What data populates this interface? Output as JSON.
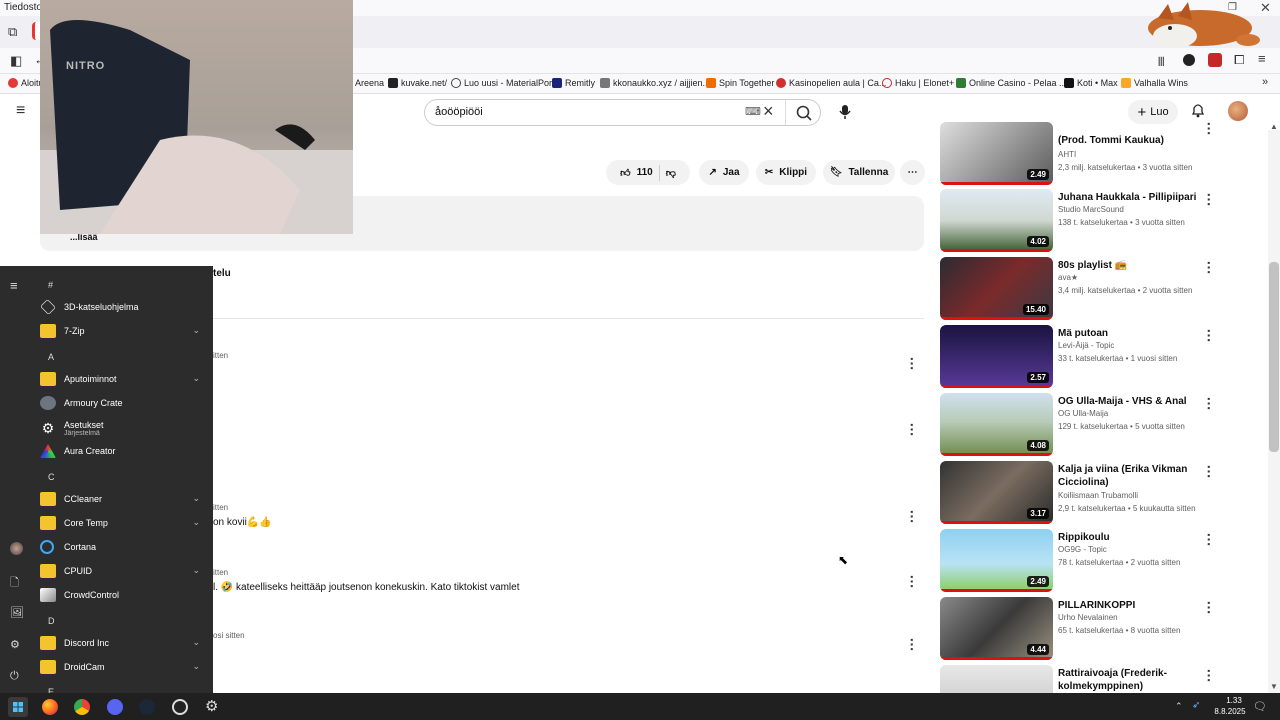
{
  "window": {
    "menu_file": "Tiedosto"
  },
  "bookmarks": [
    {
      "label": "Aloitu",
      "color": "#e53935"
    },
    {
      "label": "Areena",
      "color": "#ffffff"
    },
    {
      "label": "kuvake.net/",
      "color": "#222222"
    },
    {
      "label": "Luo uusi - MaterialPort",
      "color": "#444444"
    },
    {
      "label": "Remitly",
      "color": "#1a237e"
    },
    {
      "label": "kkonaukko.xyz / aijjien...",
      "color": "#555555"
    },
    {
      "label": "Spin Together",
      "color": "#ef6c00"
    },
    {
      "label": "Kasinopelien aula | Ca...",
      "color": "#d32f2f"
    },
    {
      "label": "Haku | Elonet+",
      "color": "#c62828"
    },
    {
      "label": "Online Casino - Pelaa ...",
      "color": "#2e7d32"
    },
    {
      "label": "Koti • Max",
      "color": "#111111"
    },
    {
      "label": "Valhalla Wins",
      "color": "#f9a825"
    }
  ],
  "header": {
    "search_value": "åoööpiööi",
    "create_label": "Luo"
  },
  "actions": {
    "likes": "110",
    "share": "Jaa",
    "clip": "Klippi",
    "save": "Tallenna"
  },
  "description": {
    "more": "...lisää"
  },
  "comments": {
    "heading_fragment": "telu",
    "items": [
      {
        "time": "itten",
        "text": ""
      },
      {
        "time": "itten",
        "text": "on kovii💪👍"
      },
      {
        "time": "itten",
        "text": "l. 🤣 kateelliseks heittääp joutsenon konekuskin. Kato tiktokist vamlet"
      },
      {
        "time": "osi sitten",
        "text": ""
      }
    ]
  },
  "recommendations": [
    {
      "title": "(Prod. Tommi Kaukua)",
      "channel": "AHTI",
      "meta": "2,3 milj. katselukertaa • 3 vuotta sitten",
      "duration": "2.49"
    },
    {
      "title": "Juhana Haukkala - Pillipiipari",
      "channel": "Studio MarcSound",
      "meta": "138 t. katselukertaa • 3 vuotta sitten",
      "duration": "4.02"
    },
    {
      "title": "80s playlist 📻",
      "channel": "ava★",
      "meta": "3,4 milj. katselukertaa • 2 vuotta sitten",
      "duration": "15.40"
    },
    {
      "title": "Mä putoan",
      "channel": "Levi-Äijä - Topic",
      "meta": "33 t. katselukertaa • 1 vuosi sitten",
      "duration": "2.57"
    },
    {
      "title": "OG Ulla-Maija - VHS & Anal",
      "channel": "OG Ulla-Maija",
      "meta": "129 t. katselukertaa • 5 vuotta sitten",
      "duration": "4.08"
    },
    {
      "title": "Kalja ja viina (Erika Vikman Cicciolina)",
      "channel": "Koiliismaan Trubamolli",
      "meta": "2,9 t. katselukertaa • 5 kuukautta sitten",
      "duration": "3.17"
    },
    {
      "title": "Rippikoulu",
      "channel": "OG9G - Topic",
      "meta": "78 t. katselukertaa • 2 vuotta sitten",
      "duration": "2.49"
    },
    {
      "title": "PILLARINKOPPI",
      "channel": "Urho Nevalainen",
      "meta": "65 t. katselukertaa • 8 vuotta sitten",
      "duration": "4.44"
    },
    {
      "title": "Rattiraivoaja (Frederik- kolmekymppinen)",
      "channel": "",
      "meta": "",
      "duration": ""
    }
  ],
  "webcam": {
    "chair_text": "NITRO"
  },
  "startmenu": {
    "entries": [
      {
        "kind": "header",
        "label": "#"
      },
      {
        "kind": "app",
        "label": "3D-katseluohjelma",
        "icon": "cube-icon"
      },
      {
        "kind": "folder",
        "label": "7-Zip"
      },
      {
        "kind": "header",
        "label": "A"
      },
      {
        "kind": "folder",
        "label": "Aputoiminnot"
      },
      {
        "kind": "app",
        "label": "Armoury Crate",
        "icon": "armoury-crate-icon"
      },
      {
        "kind": "app",
        "label": "Asetukset",
        "sub": "Järjestelmä",
        "icon": "gear-icon"
      },
      {
        "kind": "app",
        "label": "Aura Creator",
        "icon": "aura-creator-icon"
      },
      {
        "kind": "header",
        "label": "C"
      },
      {
        "kind": "folder",
        "label": "CCleaner"
      },
      {
        "kind": "folder",
        "label": "Core Temp"
      },
      {
        "kind": "app",
        "label": "Cortana",
        "icon": "cortana-icon"
      },
      {
        "kind": "folder",
        "label": "CPUID"
      },
      {
        "kind": "app",
        "label": "CrowdControl",
        "icon": "crowdcontrol-icon"
      },
      {
        "kind": "header",
        "label": "D"
      },
      {
        "kind": "folder",
        "label": "Discord Inc"
      },
      {
        "kind": "folder",
        "label": "DroidCam"
      },
      {
        "kind": "header",
        "label": "E"
      }
    ]
  },
  "taskbar": {
    "time": "1.33",
    "date": "8.8.2025"
  }
}
